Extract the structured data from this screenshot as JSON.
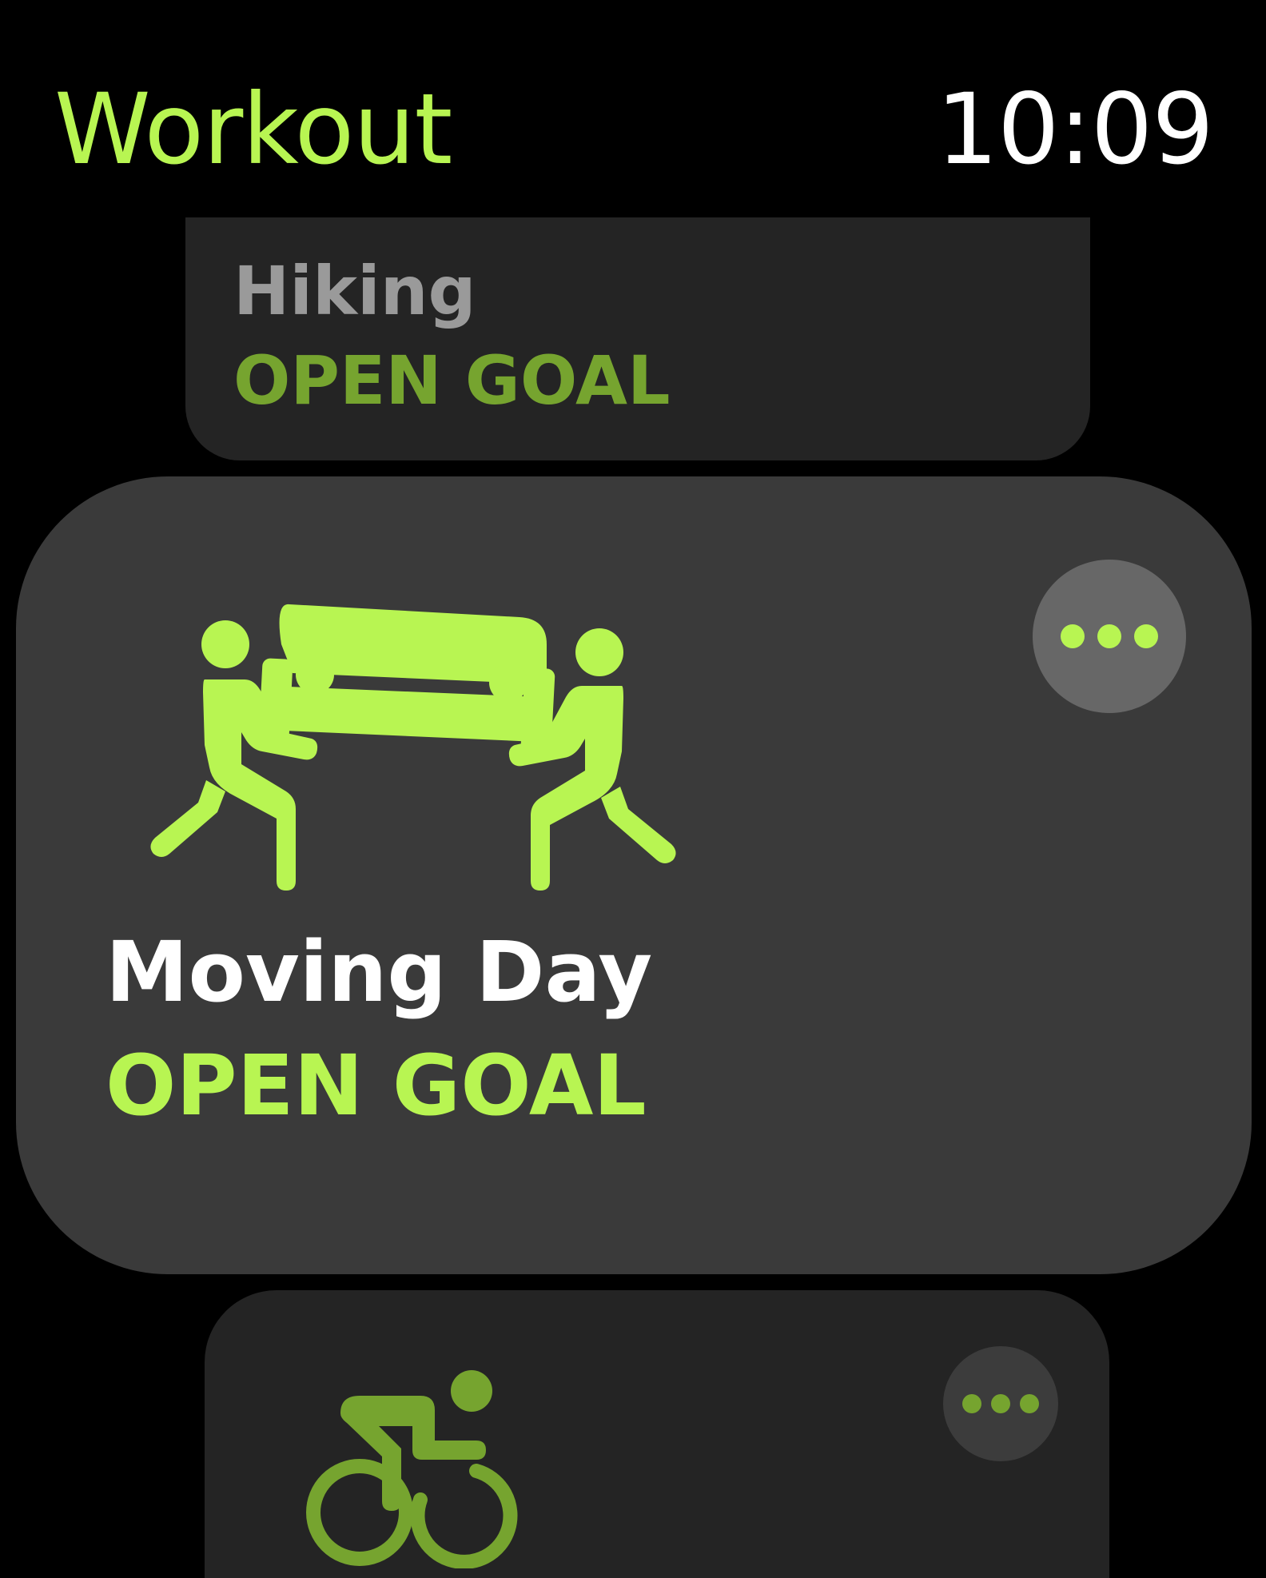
{
  "colors": {
    "accent": "#b8f552",
    "accent_dim": "#76a42f",
    "background": "#000000",
    "card_dim": "#242424",
    "card_active": "#3a3a3a",
    "more_active": "#676767",
    "more_dim": "#3c3c3c",
    "text_white": "#ffffff",
    "text_gray": "#9a9a9a"
  },
  "header": {
    "title": "Workout",
    "time": "10:09"
  },
  "workouts": [
    {
      "title": "Hiking",
      "goal": "OPEN GOAL",
      "icon": "hiking-icon",
      "state": "dimmed"
    },
    {
      "title": "Moving Day",
      "goal": "OPEN GOAL",
      "icon": "moving-day-icon",
      "state": "focused",
      "more_icon": "ellipsis-icon"
    },
    {
      "title": "",
      "goal": "",
      "icon": "cycling-icon",
      "state": "dimmed",
      "more_icon": "ellipsis-icon"
    }
  ]
}
